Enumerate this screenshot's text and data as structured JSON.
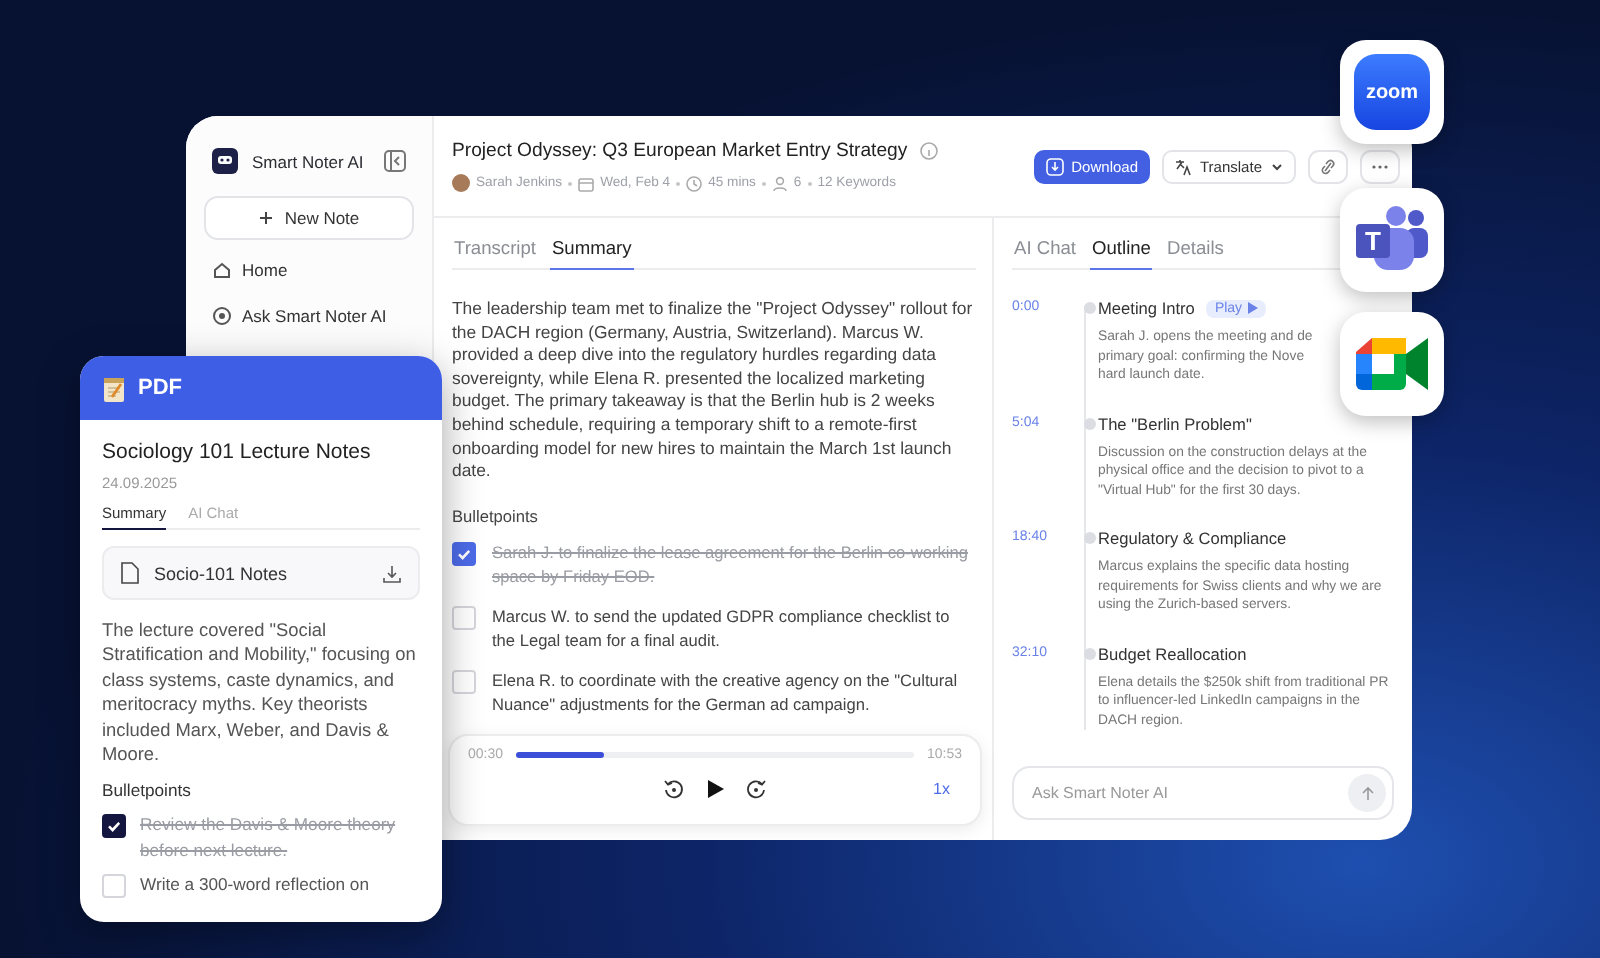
{
  "app": {
    "name": "Smart Noter AI",
    "new_note": "New Note",
    "nav": [
      {
        "label": "Home"
      },
      {
        "label": "Ask Smart Noter AI"
      }
    ],
    "note": {
      "title": "Project Odyssey: Q3 European Market Entry Strategy",
      "author": "Sarah Jenkins",
      "date": "Wed, Feb 4",
      "duration": "45 mins",
      "attendees": "6",
      "keywords": "12 Keywords"
    },
    "actions": {
      "download": "Download",
      "translate": "Translate"
    },
    "tabs": [
      {
        "label": "Transcript",
        "selected": false
      },
      {
        "label": "Summary",
        "selected": true
      }
    ],
    "summary": "The leadership team met to finalize the \"Project Odyssey\" rollout for the DACH region (Germany, Austria, Switzerland). Marcus W. provided a deep dive into the regulatory hurdles regarding data sovereignty, while Elena R. presented the localized marketing budget. The primary takeaway is that the Berlin hub is 2 weeks behind schedule, requiring a temporary shift to a remote-first onboarding model for new hires to maintain the March 1st launch date.",
    "bullets_heading": "Bulletpoints",
    "bullets": [
      {
        "text": "Sarah J. to finalize the lease agreement for the Berlin co-working space by Friday EOD.",
        "checked": true
      },
      {
        "text": "Marcus W. to send the updated GDPR compliance checklist to the Legal team for a final audit.",
        "checked": false
      },
      {
        "text": "Elena R. to coordinate with the creative agency on the \"Cultural Nuance\" adjustments for the German ad campaign.",
        "checked": false
      }
    ],
    "player": {
      "current": "00:30",
      "total": "10:53",
      "level": 0.22,
      "speed": "1x"
    },
    "side_tabs": [
      {
        "label": "AI Chat",
        "selected": false
      },
      {
        "label": "Outline",
        "selected": true
      },
      {
        "label": "Details",
        "selected": false
      }
    ],
    "outline": [
      {
        "time": "0:00",
        "title": "Meeting Intro",
        "play": "Play",
        "description": "Sarah J. opens the meeting and de\nprimary goal: confirming the Nove\nhard launch date."
      },
      {
        "time": "5:04",
        "title": "The \"Berlin Problem\"",
        "description": "Discussion on the construction delays at the physical office and the decision to pivot to a \"Virtual Hub\" for the first 30 days."
      },
      {
        "time": "18:40",
        "title": "Regulatory & Compliance",
        "description": "Marcus explains the specific data hosting requirements for Swiss clients and why we are using the Zurich-based servers."
      },
      {
        "time": "32:10",
        "title": "Budget Reallocation",
        "description": "Elena details the $250k shift from traditional PR to influencer-led LinkedIn campaigns in the DACH region."
      }
    ],
    "chat": {
      "placeholder": "Ask Smart Noter AI"
    }
  },
  "pdf_card": {
    "badge": "PDF",
    "title": "Sociology 101 Lecture Notes",
    "date": "24.09.2025",
    "tabs": [
      {
        "label": "Summary",
        "selected": true
      },
      {
        "label": "AI Chat",
        "selected": false
      }
    ],
    "file": "Socio-101 Notes",
    "summary": "The lecture covered \"Social Stratification and Mobility,\" focusing on class systems, caste dynamics, and meritocracy myths. Key theorists included Marx, Weber, and Davis & Moore.",
    "bullets_heading": "Bulletpoints",
    "bullets": [
      {
        "text": "Review the Davis & Moore theory before next lecture.",
        "checked": true
      },
      {
        "text": "Write a 300-word reflection on",
        "checked": false
      }
    ]
  },
  "integrations": [
    {
      "kind": "zoom",
      "label": "zoom"
    },
    {
      "kind": "teams",
      "label": "T"
    },
    {
      "kind": "meet"
    }
  ]
}
